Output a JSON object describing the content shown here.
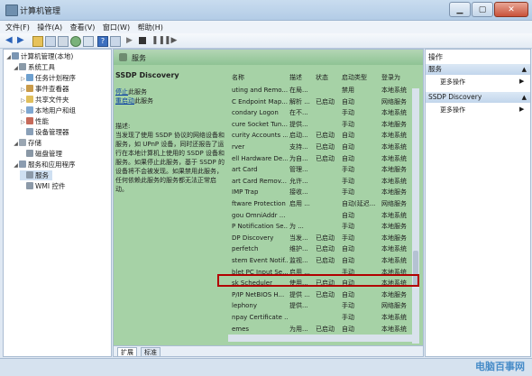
{
  "window": {
    "title": "计算机管理"
  },
  "menu": [
    "文件(F)",
    "操作(A)",
    "查看(V)",
    "窗口(W)",
    "帮助(H)"
  ],
  "tree": [
    {
      "label": "计算机管理(本地)",
      "indent": 0,
      "exp": "◢"
    },
    {
      "label": "系统工具",
      "indent": 1,
      "exp": "◢"
    },
    {
      "label": "任务计划程序",
      "indent": 2,
      "exp": "▷"
    },
    {
      "label": "事件查看器",
      "indent": 2,
      "exp": "▷"
    },
    {
      "label": "共享文件夹",
      "indent": 2,
      "exp": "▷"
    },
    {
      "label": "本地用户和组",
      "indent": 2,
      "exp": "▷"
    },
    {
      "label": "性能",
      "indent": 2,
      "exp": "▷"
    },
    {
      "label": "设备管理器",
      "indent": 2,
      "exp": ""
    },
    {
      "label": "存储",
      "indent": 1,
      "exp": "◢"
    },
    {
      "label": "磁盘管理",
      "indent": 2,
      "exp": ""
    },
    {
      "label": "服务和应用程序",
      "indent": 1,
      "exp": "◢"
    },
    {
      "label": "服务",
      "indent": 2,
      "exp": ""
    },
    {
      "label": "WMI 控件",
      "indent": 2,
      "exp": ""
    }
  ],
  "center": {
    "header": "服务",
    "desc_title": "SSDP Discovery",
    "stop_link": "停止",
    "stop_suffix": "此服务",
    "restart_link": "重启动",
    "restart_suffix": "此服务",
    "desc_label": "描述:",
    "desc_text": "当发现了使用 SSDP 协议的网络设备和服务，如 UPnP 设备，同时还报告了运行在本地计算机上使用的 SSDP 设备和服务。如果停止此服务，基于 SSDP 的设备将不会被发现。如果禁用此服务，任何依赖此服务的服务都无法正常启动。"
  },
  "grid": {
    "columns": [
      "名称",
      "描述",
      "状态",
      "启动类型",
      "登录为"
    ],
    "rows": [
      [
        "uting and Remo...",
        "在局...",
        "",
        "禁用",
        "本地系统"
      ],
      [
        "C Endpoint Map...",
        "解析 ...",
        "已启动",
        "自动",
        "网络服务"
      ],
      [
        "condary Logon",
        "在不...",
        "",
        "手动",
        "本地系统"
      ],
      [
        "cure Socket Tun...",
        "提供...",
        "",
        "手动",
        "本地服务"
      ],
      [
        "curity Accounts ...",
        "启动...",
        "已启动",
        "自动",
        "本地系统"
      ],
      [
        "rver",
        "支持...",
        "已启动",
        "自动",
        "本地系统"
      ],
      [
        "ell Hardware De...",
        "为自...",
        "已启动",
        "自动",
        "本地系统"
      ],
      [
        "art Card",
        "管理...",
        "",
        "手动",
        "本地服务"
      ],
      [
        "art Card Remov...",
        "允许...",
        "",
        "手动",
        "本地系统"
      ],
      [
        "IMP Trap",
        "接收...",
        "",
        "手动",
        "本地服务"
      ],
      [
        "ftware Protection",
        "启用 ...",
        "",
        "自动(延迟...",
        "网络服务"
      ],
      [
        "gou OmniAddr ...",
        "",
        "",
        "自动",
        "本地系统"
      ],
      [
        "P Notification Se...",
        "为 ...",
        "",
        "手动",
        "本地服务"
      ],
      [
        "DP Discovery",
        "当发...",
        "已启动",
        "手动",
        "本地服务"
      ],
      [
        "perfetch",
        "维护...",
        "已启动",
        "自动",
        "本地系统"
      ],
      [
        "stem Event Notif...",
        "监视...",
        "已启动",
        "自动",
        "本地系统"
      ],
      [
        "blet PC Input Se...",
        "启用 ...",
        "",
        "手动",
        "本地系统"
      ],
      [
        "sk Scheduler",
        "使用...",
        "已启动",
        "自动",
        "本地系统"
      ],
      [
        "P/IP NetBIOS H...",
        "提供 ...",
        "已启动",
        "自动",
        "本地服务"
      ],
      [
        "lephony",
        "提供...",
        "",
        "手动",
        "网络服务"
      ],
      [
        "npay Certificate ...",
        "",
        "",
        "手动",
        "本地系统"
      ],
      [
        "emes",
        "为用...",
        "已启动",
        "自动",
        "本地系统"
      ],
      [
        "",
        "",
        "",
        "",
        ""
      ]
    ]
  },
  "tabs": [
    "扩展",
    "标准"
  ],
  "actions": {
    "title": "操作",
    "group1": "服务",
    "more1": "更多操作",
    "group2": "SSDP Discovery",
    "more2": "更多操作"
  },
  "watermark": "电脑百事网"
}
